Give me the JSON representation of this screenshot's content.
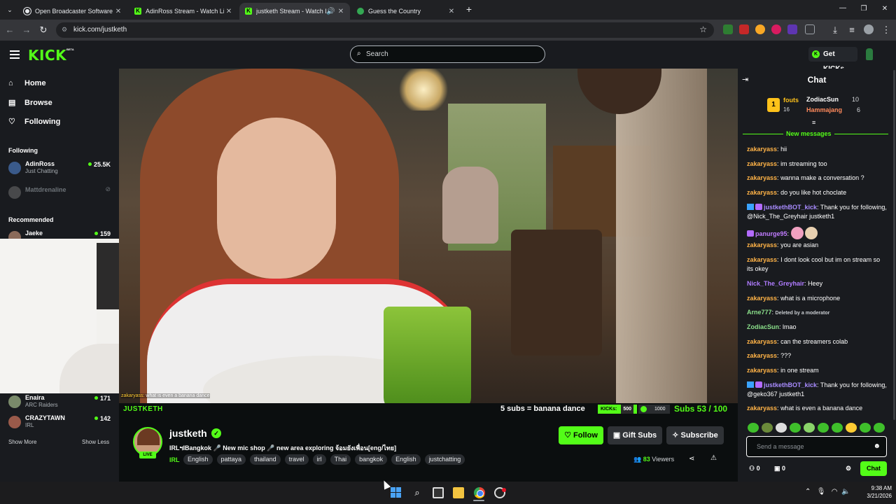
{
  "browser": {
    "tabs": [
      {
        "title": "Open Broadcaster Software | O",
        "favicon": "obs-icon",
        "active": false
      },
      {
        "title": "AdinRoss Stream - Watch Live o",
        "favicon": "kick-icon",
        "active": false
      },
      {
        "title": "justketh Stream - Watch Liv",
        "favicon": "kick-icon",
        "active": true
      },
      {
        "title": "Guess the Country",
        "favicon": "globe-icon",
        "active": false
      }
    ],
    "new_tab": "+",
    "url": "kick.com/justketh"
  },
  "kick": {
    "logo": "KICK",
    "beta": "BETA",
    "search_placeholder": "Search",
    "get_kicks": "Get KICKs"
  },
  "sidebar": {
    "nav": [
      {
        "label": "Home",
        "icon": "home-icon"
      },
      {
        "label": "Browse",
        "icon": "browse-icon"
      },
      {
        "label": "Following",
        "icon": "heart-icon"
      }
    ],
    "following_title": "Following",
    "following": [
      {
        "name": "AdinRoss",
        "category": "Just Chatting",
        "viewers": "25.5K"
      },
      {
        "name": "Mattdrenaline",
        "category": "",
        "viewers": ""
      }
    ],
    "recommended_title": "Recommended",
    "recommended": [
      {
        "name": "Jaeke",
        "category": "",
        "viewers": "159"
      },
      {
        "name": "Enaira",
        "category": "ARC Raiders",
        "viewers": "171"
      },
      {
        "name": "CRAZYTAWN",
        "category": "IRL",
        "viewers": "142"
      }
    ],
    "show_more": "Show More",
    "show_less": "Show Less"
  },
  "player": {
    "overlay_user": "zakaryass:",
    "overlay_text": "what is even a banana dance",
    "brand": "JUSTKETH",
    "goal_text": "5 subs = banana dance",
    "kicks_label": "KICKs:",
    "kicks_value": "500",
    "progress_value": "1000",
    "subs_text": "Subs 53 / 100"
  },
  "channel": {
    "name": "justketh",
    "live_label": "LIVE",
    "title": "IRLฯIBangkok 🎤 New mic shop 🎤 new area exploring จ้อมยังเพื่อน[eng/ไทย]",
    "category": "IRL",
    "tags": [
      "English",
      "pattaya",
      "thailand",
      "travel",
      "irl",
      "Thai",
      "bangkok",
      "English",
      "justchatting"
    ],
    "follow": "Follow",
    "gift_subs": "Gift Subs",
    "subscribe": "Subscribe",
    "viewers_count": "83",
    "viewers_label": "Viewers"
  },
  "chat": {
    "title": "Chat",
    "pinned": {
      "rank_user": "fouts",
      "rank_count": "16",
      "user2": "ZodiacSun",
      "count2": "10",
      "user3": "Hammajang",
      "count3": "6"
    },
    "new_messages": "New messages",
    "messages": [
      {
        "user": "zakaryass",
        "color": "#ffb347",
        "text": "hii"
      },
      {
        "user": "zakaryass",
        "color": "#ffb347",
        "text": "im streaming too"
      },
      {
        "user": "zakaryass",
        "color": "#ffb347",
        "text": "wanna make a conversation ?"
      },
      {
        "user": "zakaryass",
        "color": "#ffb347",
        "text": "do you like hot choclate"
      },
      {
        "user": "justkethBOT_kick",
        "color": "#a98cff",
        "text": "Thank you for following, @Nick_The_Greyhair justketh1"
      },
      {
        "user": "panurge95",
        "color": "#c07cff",
        "text": ""
      },
      {
        "user": "zakaryass",
        "color": "#ffb347",
        "text": "you are asian"
      },
      {
        "user": "zakaryass",
        "color": "#ffb347",
        "text": "I dont look cool but im on stream so its okey"
      },
      {
        "user": "Nick_The_Greyhair",
        "color": "#b07cff",
        "text": "Heey"
      },
      {
        "user": "zakaryass",
        "color": "#ffb347",
        "text": "what is a microphone"
      },
      {
        "user": "Arne777",
        "color": "#8be08b",
        "text": "Deleted by a moderator"
      },
      {
        "user": "ZodiacSun",
        "color": "#8be08b",
        "text": "lmao"
      },
      {
        "user": "zakaryass",
        "color": "#ffb347",
        "text": "can the streamers colab"
      },
      {
        "user": "zakaryass",
        "color": "#ffb347",
        "text": "???"
      },
      {
        "user": "zakaryass",
        "color": "#ffb347",
        "text": "in one stream"
      },
      {
        "user": "justkethBOT_kick",
        "color": "#a98cff",
        "text": "Thank you for following, @geko367 justketh1"
      },
      {
        "user": "zakaryass",
        "color": "#ffb347",
        "text": "what is even a banana dance"
      }
    ],
    "input_placeholder": "Send a message",
    "footer_count1": "0",
    "footer_count2": "0",
    "send_label": "Chat"
  },
  "taskbar": {
    "time": "9:38 AM",
    "date": "3/21/2026"
  },
  "colors": {
    "kick_green": "#53fc18",
    "bg": "#0b0e0f",
    "panel": "#191b1f"
  }
}
